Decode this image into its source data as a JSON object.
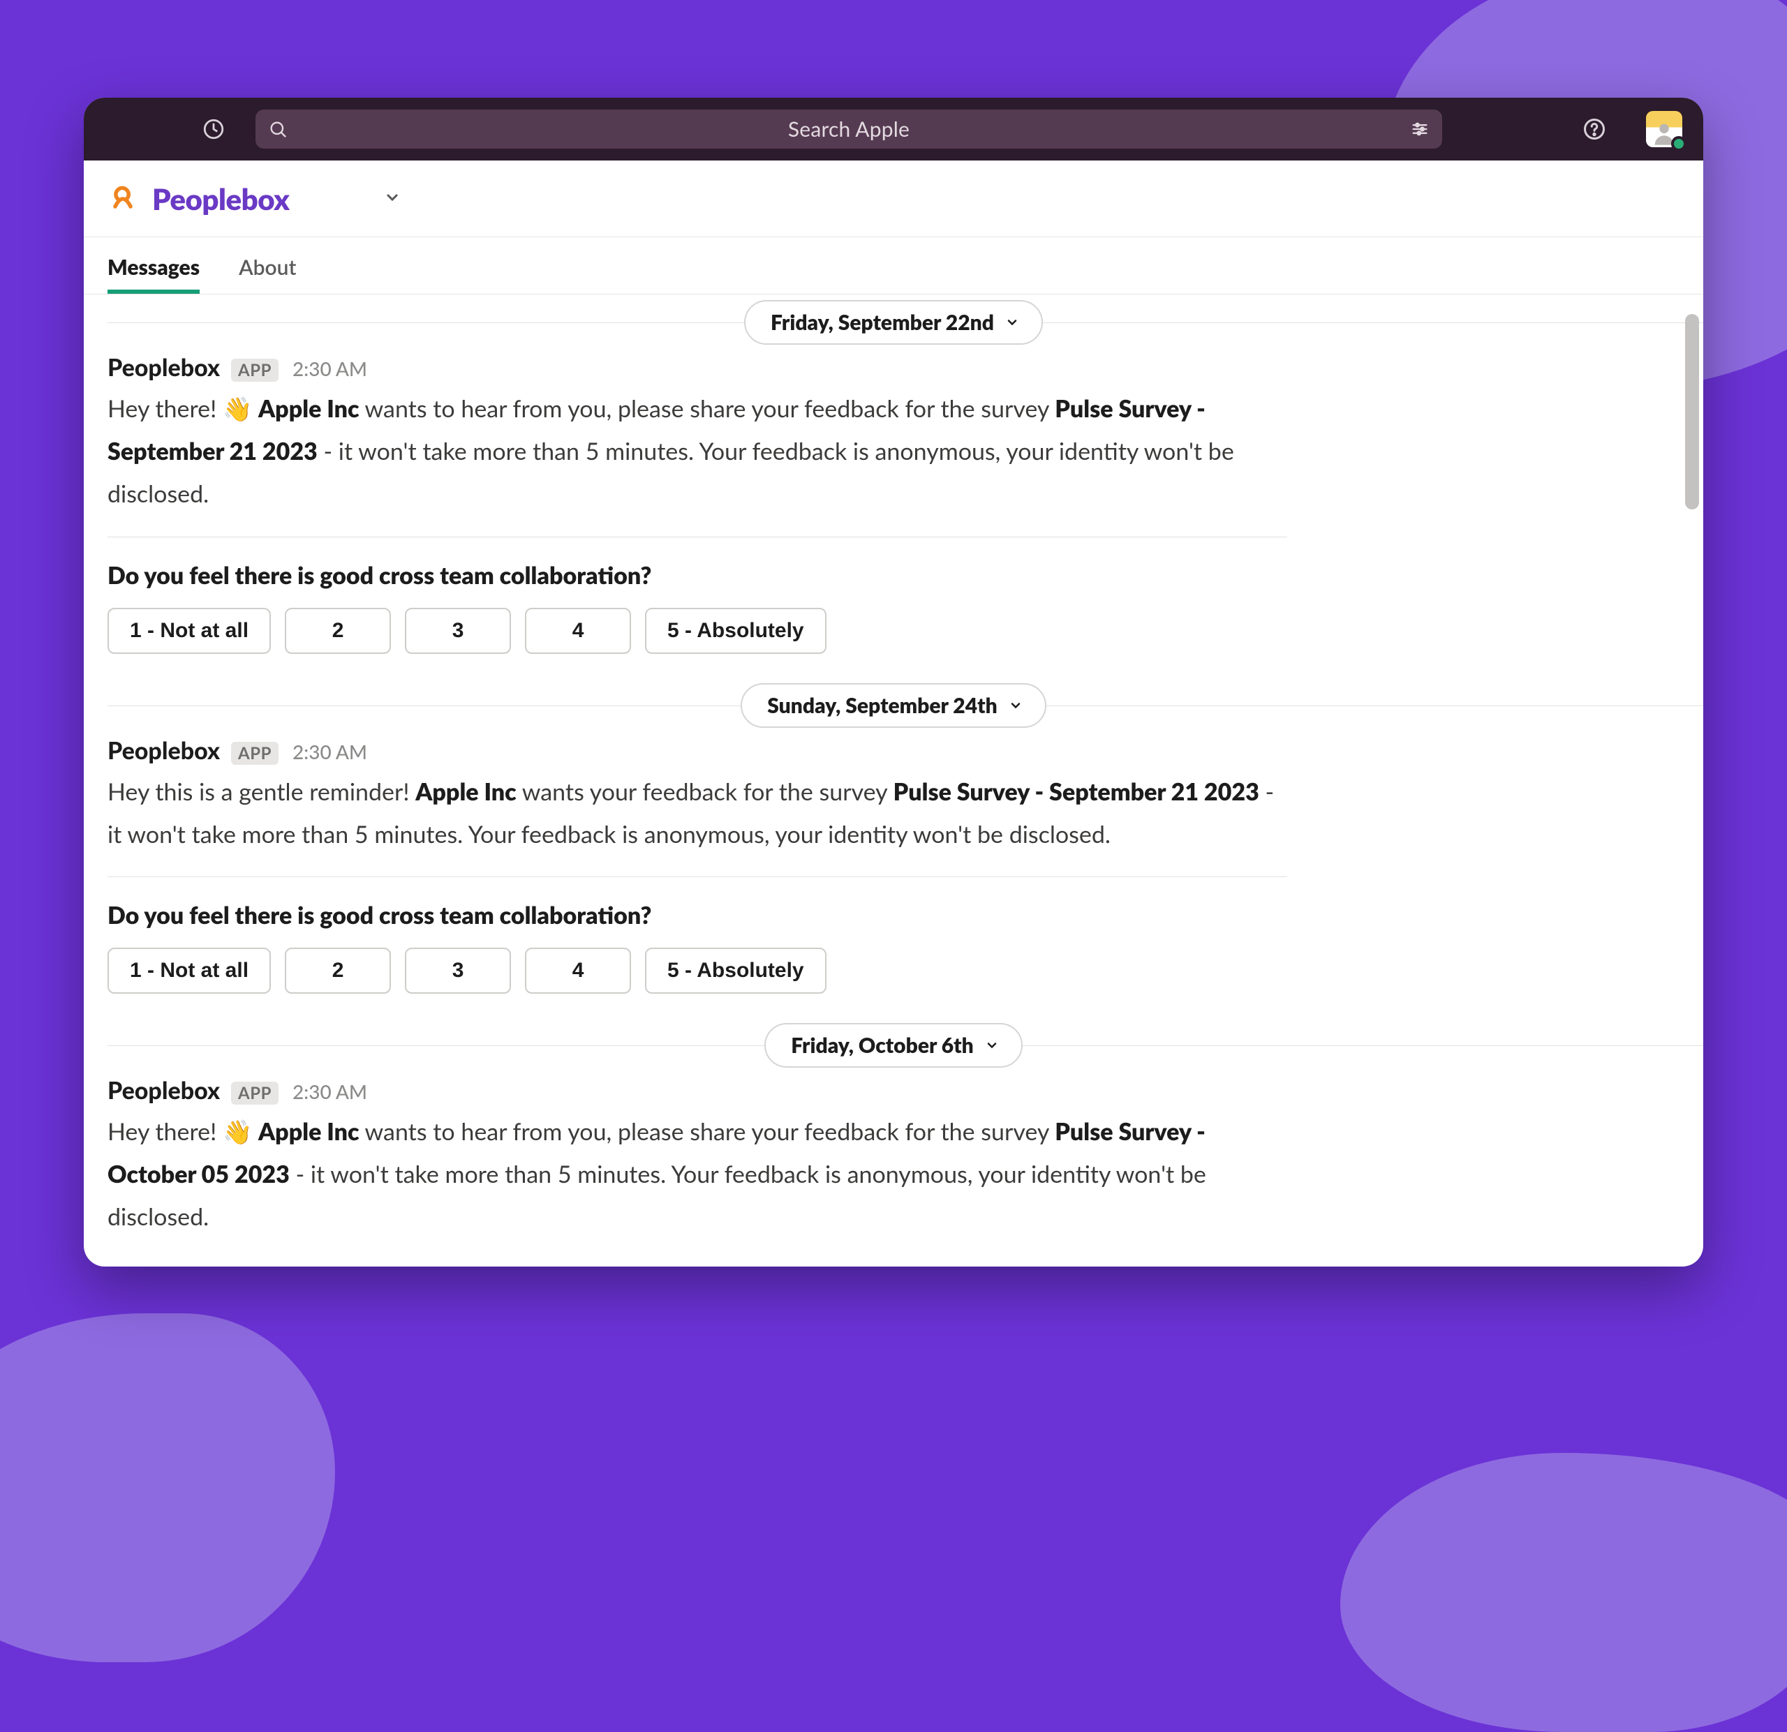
{
  "titlebar": {
    "search_placeholder": "Search Apple"
  },
  "channel": {
    "title": "Peoplebox"
  },
  "tabs": {
    "messages": "Messages",
    "about": "About"
  },
  "dates": {
    "d1": "Friday, September 22nd",
    "d2": "Sunday, September 24th",
    "d3": "Friday, October 6th"
  },
  "app_badge": "APP",
  "messages": {
    "m1": {
      "user": "Peoplebox",
      "time": "2:30 AM",
      "p1a": "Hey there! ",
      "p1_company": "Apple Inc",
      "p1b": " wants to hear from you, please share your feedback for the survey ",
      "p1_survey": "Pulse Survey - September 21 2023",
      "p1c": " - it won't take more than 5 minutes. Your feedback is anonymous, your identity won't be disclosed."
    },
    "m2": {
      "user": "Peoplebox",
      "time": "2:30 AM",
      "p1a": "Hey this is a gentle reminder! ",
      "p1_company": "Apple Inc",
      "p1b": " wants your feedback for the survey ",
      "p1_survey": "Pulse Survey - September 21 2023",
      "p1c": " - it won't take more than 5 minutes. Your feedback is anonymous, your identity won't be disclosed."
    },
    "m3": {
      "user": "Peoplebox",
      "time": "2:30 AM",
      "p1a": "Hey there! ",
      "p1_company": "Apple Inc",
      "p1b": " wants to hear from you, please share your feedback for the survey ",
      "p1_survey": "Pulse Survey - October 05 2023",
      "p1c": " - it won't take more than 5 minutes. Your feedback is anonymous, your identity won't be disclosed."
    }
  },
  "question": {
    "q_text": "Do you feel there is good cross team collaboration?",
    "opts": {
      "o1": "1 - Not at all",
      "o2": "2",
      "o3": "3",
      "o4": "4",
      "o5": "5 - Absolutely"
    }
  }
}
